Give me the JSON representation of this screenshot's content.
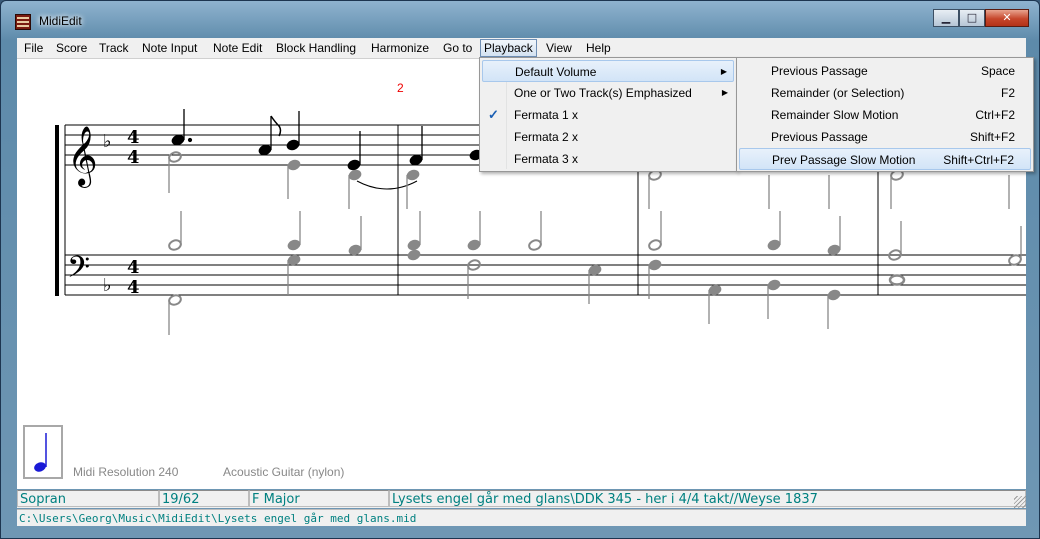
{
  "window": {
    "title": "MidiEdit",
    "minimize": "▁",
    "maximize": "□",
    "close": "✕"
  },
  "menubar": {
    "items": [
      "File",
      "Score",
      "Track",
      "Note Input",
      "Note Edit",
      "Block Handling",
      "Harmonize",
      "Go to",
      "Playback",
      "View",
      "Help"
    ],
    "active": "Playback"
  },
  "playback_menu": {
    "items": [
      {
        "label": "Default Volume",
        "submenu": true,
        "checked": false,
        "highlighted": true
      },
      {
        "label": "One or Two Track(s) Emphasized",
        "submenu": true,
        "checked": false,
        "highlighted": false
      },
      {
        "label": "Fermata 1 x",
        "submenu": false,
        "checked": true,
        "highlighted": false
      },
      {
        "label": "Fermata 2 x",
        "submenu": false,
        "checked": false,
        "highlighted": false
      },
      {
        "label": "Fermata 3 x",
        "submenu": false,
        "checked": false,
        "highlighted": false
      }
    ]
  },
  "submenu": {
    "items": [
      {
        "label": "Previous Passage",
        "shortcut": "Space",
        "highlighted": false
      },
      {
        "label": "Remainder (or Selection)",
        "shortcut": "F2",
        "highlighted": false
      },
      {
        "label": "Remainder Slow Motion",
        "shortcut": "Ctrl+F2",
        "highlighted": false
      },
      {
        "label": "Previous Passage",
        "shortcut": "Shift+F2",
        "highlighted": false
      },
      {
        "label": "Prev Passage Slow Motion",
        "shortcut": "Shift+Ctrl+F2",
        "highlighted": true
      }
    ]
  },
  "score": {
    "measure_number": "2",
    "time_signature_top": "4",
    "time_signature_bottom": "4",
    "midi_resolution": "Midi Resolution 240",
    "instrument": "Acoustic Guitar (nylon)"
  },
  "status": {
    "track": "Sopran",
    "position": "19/62",
    "key": "F Major",
    "title": "Lysets engel går med glans\\DDK 345 - her i 4/4 takt//Weyse 1837",
    "path": "C:\\Users\\Georg\\Music\\MidiEdit\\Lysets engel går med glans.mid"
  },
  "colors": {
    "status_text": "#008080",
    "measure_number": "#ee0000",
    "gray_notes": "#888888",
    "current_note": "#1a1ad6"
  }
}
